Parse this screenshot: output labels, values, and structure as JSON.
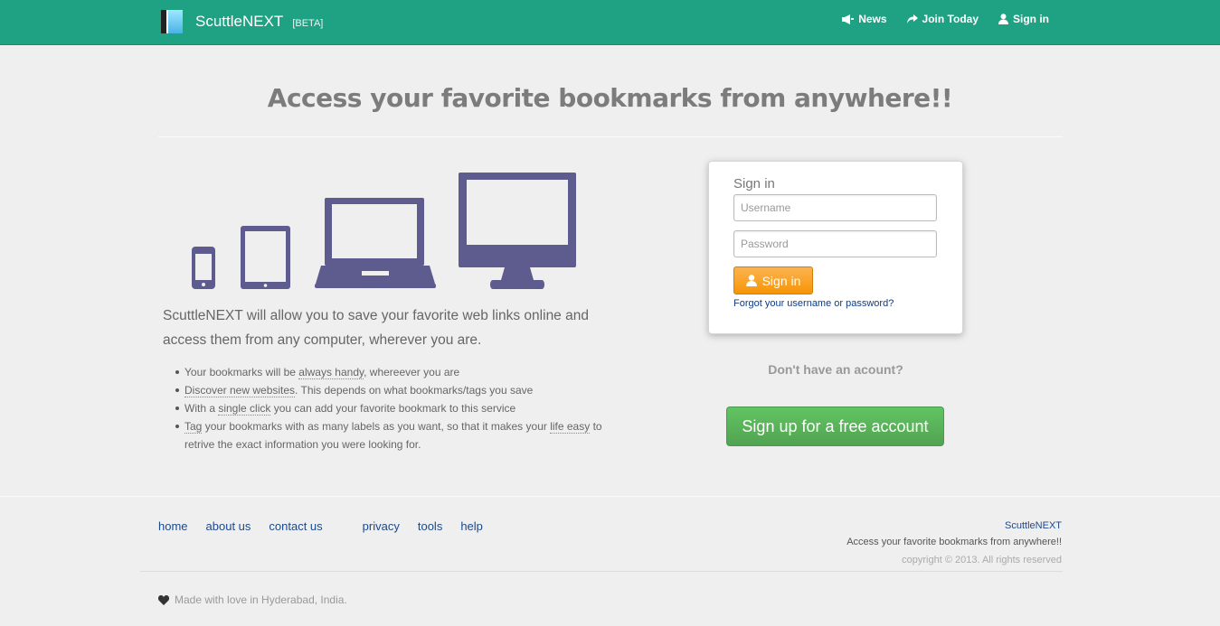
{
  "navbar": {
    "brand": "ScuttleNEXT",
    "beta": "[BETA]",
    "links": [
      {
        "label": "News",
        "icon": "bullhorn-icon"
      },
      {
        "label": "Join Today",
        "icon": "share-arrow-icon"
      },
      {
        "label": "Sign in",
        "icon": "user-icon"
      }
    ]
  },
  "hero": {
    "title": "Access your favorite bookmarks from anywhere!!",
    "lead": "ScuttleNEXT will allow you to save your favorite web links online and access them from any computer, wherever you are.",
    "features": [
      {
        "before": "Your bookmarks will be ",
        "hl": "always handy",
        "after": ", whereever you are"
      },
      {
        "before": "",
        "hl": "Discover new websites",
        "after": ". This depends on what bookmarks/tags you save"
      },
      {
        "before": "With a ",
        "hl": "single click",
        "after": " you can add your favorite bookmark to this service"
      },
      {
        "before": "",
        "hl": "Tag",
        "after": " your bookmarks with as many labels as you want, so that it makes your ",
        "hl2": "life easy",
        "after2": " to retrive the exact information you were looking for."
      }
    ]
  },
  "signin": {
    "title": "Sign in",
    "username_placeholder": "Username",
    "password_placeholder": "Password",
    "button": "Sign in",
    "forgot": "Forgot your username or password?"
  },
  "signup": {
    "prompt": "Don't have an acount?",
    "button": "Sign up for a free account"
  },
  "footer": {
    "links": [
      "home",
      "about us",
      "contact us",
      "privacy",
      "tools",
      "help"
    ],
    "brand": "ScuttleNEXT",
    "tagline": "Access your favorite bookmarks from anywhere!!",
    "copyright": "copyright © 2013. All rights reserved",
    "made": "Made with love in Hyderabad, India."
  },
  "colors": {
    "navbar": "#1fa184",
    "device": "#5e5b8f",
    "signin_button": "#f89406",
    "signup_button": "#51a351"
  }
}
